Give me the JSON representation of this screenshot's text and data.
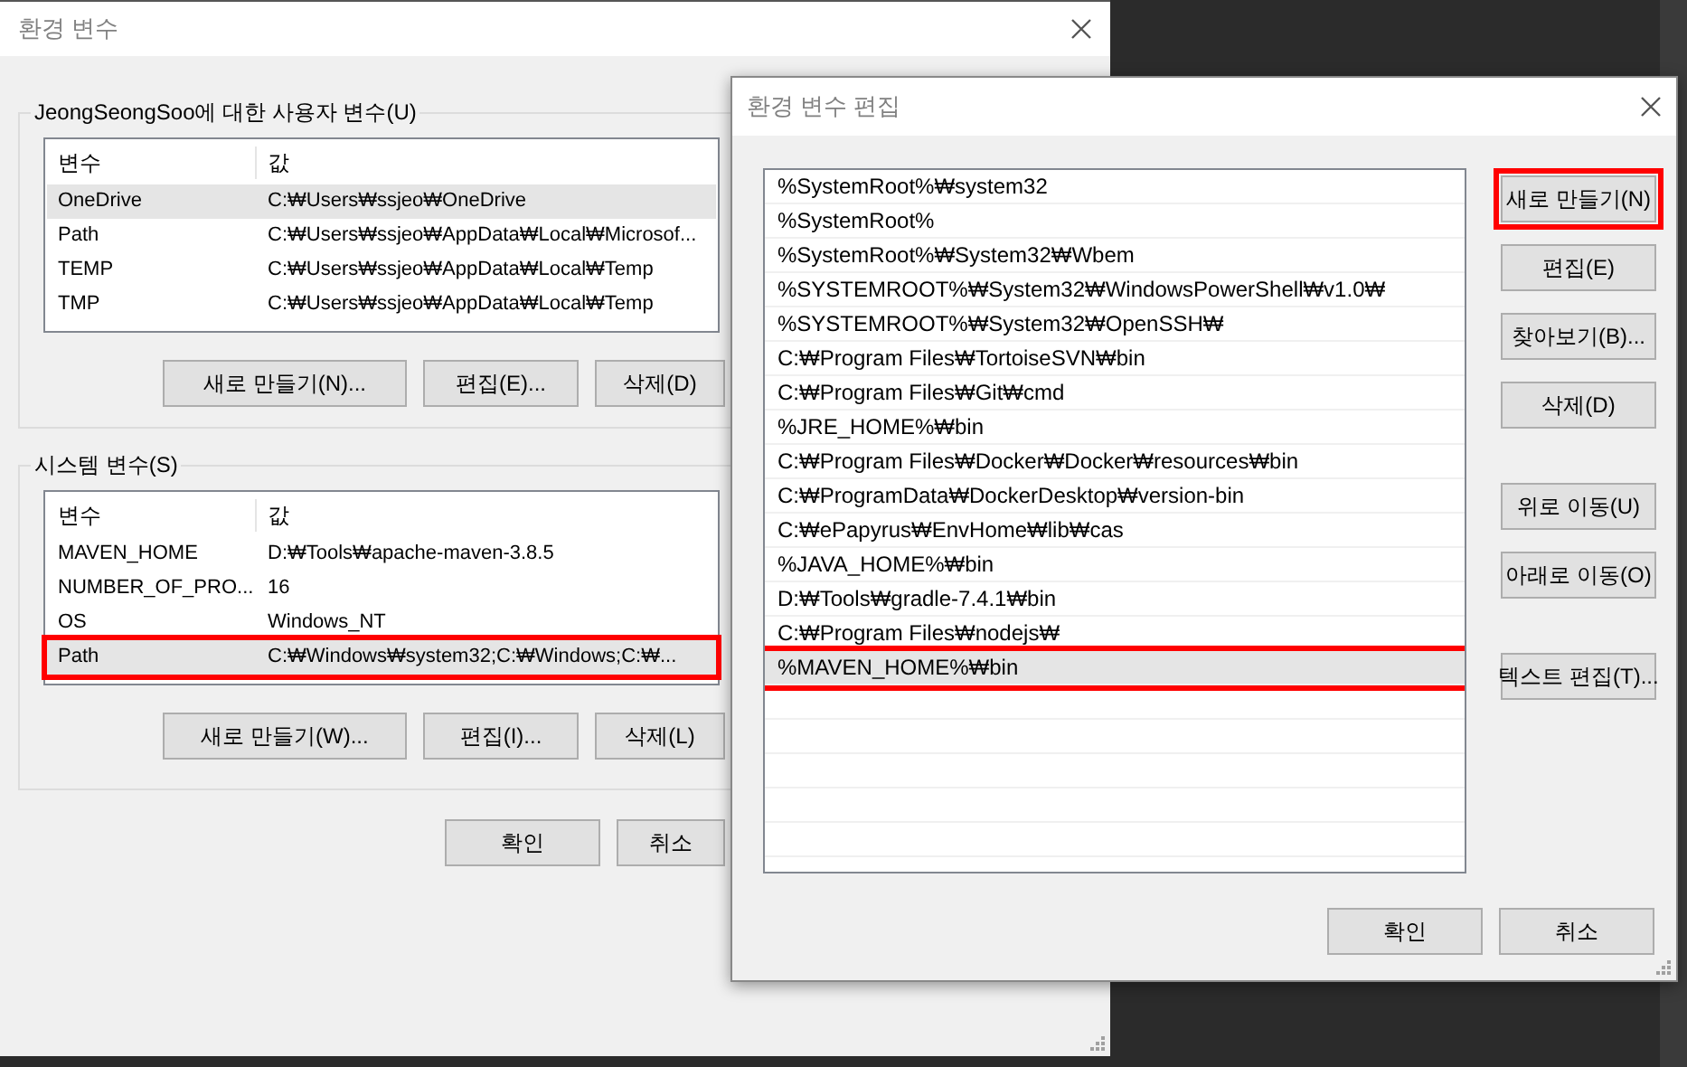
{
  "main_window": {
    "title": "환경 변수",
    "user_vars": {
      "label": "JeongSeongSoo에 대한 사용자 변수(U)",
      "columns": [
        "변수",
        "값"
      ],
      "rows": [
        {
          "name": "OneDrive",
          "value": "C:₩Users₩ssjeo₩OneDrive",
          "selected": true,
          "highlighted": false
        },
        {
          "name": "Path",
          "value": "C:₩Users₩ssjeo₩AppData₩Local₩Microsof...",
          "selected": false,
          "highlighted": false
        },
        {
          "name": "TEMP",
          "value": "C:₩Users₩ssjeo₩AppData₩Local₩Temp",
          "selected": false,
          "highlighted": false
        },
        {
          "name": "TMP",
          "value": "C:₩Users₩ssjeo₩AppData₩Local₩Temp",
          "selected": false,
          "highlighted": false
        }
      ],
      "buttons": [
        "새로 만들기(N)...",
        "편집(E)...",
        "삭제(D)"
      ]
    },
    "system_vars": {
      "label": "시스템 변수(S)",
      "columns": [
        "변수",
        "값"
      ],
      "rows": [
        {
          "name": "MAVEN_HOME",
          "value": "D:₩Tools₩apache-maven-3.8.5",
          "selected": false,
          "highlighted": false
        },
        {
          "name": "NUMBER_OF_PRO...",
          "value": "16",
          "selected": false,
          "highlighted": false
        },
        {
          "name": "OS",
          "value": "Windows_NT",
          "selected": false,
          "highlighted": false
        },
        {
          "name": "Path",
          "value": "C:₩Windows₩system32;C:₩Windows;C:₩...",
          "selected": true,
          "highlighted": true
        }
      ],
      "buttons": [
        "새로 만들기(W)...",
        "편집(I)...",
        "삭제(L)"
      ]
    },
    "buttons": [
      "확인",
      "취소"
    ]
  },
  "edit_dialog": {
    "title": "환경 변수 편집",
    "items": [
      {
        "text": "%SystemRoot%₩system32",
        "selected": false,
        "highlighted": false
      },
      {
        "text": "%SystemRoot%",
        "selected": false,
        "highlighted": false
      },
      {
        "text": "%SystemRoot%₩System32₩Wbem",
        "selected": false,
        "highlighted": false
      },
      {
        "text": "%SYSTEMROOT%₩System32₩WindowsPowerShell₩v1.0₩",
        "selected": false,
        "highlighted": false
      },
      {
        "text": "%SYSTEMROOT%₩System32₩OpenSSH₩",
        "selected": false,
        "highlighted": false
      },
      {
        "text": "C:₩Program Files₩TortoiseSVN₩bin",
        "selected": false,
        "highlighted": false
      },
      {
        "text": "C:₩Program Files₩Git₩cmd",
        "selected": false,
        "highlighted": false
      },
      {
        "text": "%JRE_HOME%₩bin",
        "selected": false,
        "highlighted": false
      },
      {
        "text": "C:₩Program Files₩Docker₩Docker₩resources₩bin",
        "selected": false,
        "highlighted": false
      },
      {
        "text": "C:₩ProgramData₩DockerDesktop₩version-bin",
        "selected": false,
        "highlighted": false
      },
      {
        "text": "C:₩ePapyrus₩EnvHome₩lib₩cas",
        "selected": false,
        "highlighted": false
      },
      {
        "text": "%JAVA_HOME%₩bin",
        "selected": false,
        "highlighted": false
      },
      {
        "text": "D:₩Tools₩gradle-7.4.1₩bin",
        "selected": false,
        "highlighted": false
      },
      {
        "text": "C:₩Program Files₩nodejs₩",
        "selected": false,
        "highlighted": false
      },
      {
        "text": "%MAVEN_HOME%₩bin",
        "selected": true,
        "highlighted": true
      }
    ],
    "button_groups": [
      [
        {
          "label": "새로 만들기(N)",
          "highlighted": true
        },
        {
          "label": "편집(E)",
          "highlighted": false
        },
        {
          "label": "찾아보기(B)...",
          "highlighted": false
        },
        {
          "label": "삭제(D)",
          "highlighted": false
        }
      ],
      [
        {
          "label": "위로 이동(U)",
          "highlighted": false
        },
        {
          "label": "아래로 이동(O)",
          "highlighted": false
        }
      ],
      [
        {
          "label": "텍스트 편집(T)...",
          "highlighted": false
        }
      ]
    ],
    "footer_buttons": [
      "확인",
      "취소"
    ]
  }
}
